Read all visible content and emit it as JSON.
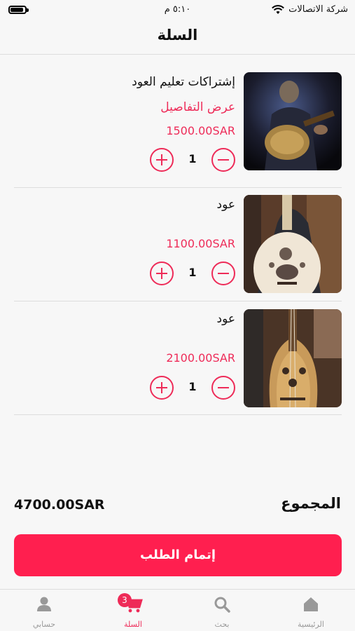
{
  "status_bar": {
    "carrier": "شركة الاتصالات",
    "time": "٥:١٠ م"
  },
  "header": {
    "title": "السلة"
  },
  "cart": {
    "items": [
      {
        "name": "إشتراكات تعليم العود",
        "details_link": "عرض التفاصيل",
        "price": "1500.00SAR",
        "quantity": "1"
      },
      {
        "name": "عود",
        "price": "1100.00SAR",
        "quantity": "1"
      },
      {
        "name": "عود",
        "price": "2100.00SAR",
        "quantity": "1"
      }
    ]
  },
  "summary": {
    "total_label": "المجموع",
    "total_value": "4700.00SAR",
    "checkout_label": "إتمام الطلب"
  },
  "tabbar": {
    "tabs": [
      {
        "label": "الرئيسية",
        "icon": "home-icon"
      },
      {
        "label": "بحث",
        "icon": "search-icon"
      },
      {
        "label": "السلة",
        "icon": "cart-icon",
        "badge": "3",
        "active": true
      },
      {
        "label": "حسابي",
        "icon": "person-icon"
      }
    ]
  },
  "colors": {
    "accent": "#ee2b58",
    "button": "#ff1f4f",
    "inactive": "#999999"
  }
}
